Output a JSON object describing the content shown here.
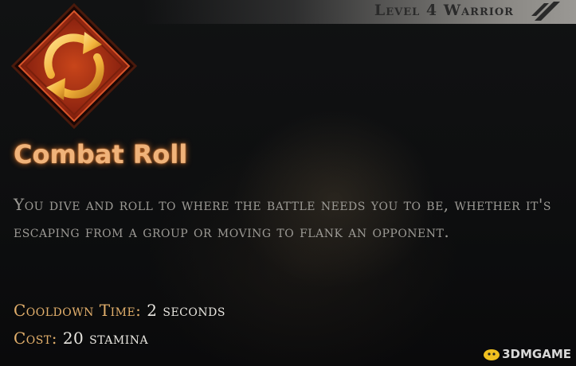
{
  "header": {
    "level_text": "Level 4 Warrior"
  },
  "ability": {
    "icon": "rotate-arrows-icon",
    "title": "Combat Roll",
    "description": "You dive and roll to where the battle needs you to be, whether it's escaping from a group or moving to flank an opponent.",
    "cooldown_label": "Cooldown Time:",
    "cooldown_value": "2 seconds",
    "cost_label": "Cost:",
    "cost_value": "20 stamina"
  },
  "watermark": {
    "text": "3DMGAME"
  },
  "colors": {
    "accent": "#e3b06c",
    "title_glow": "#f0b37a",
    "icon_red": "#b83212",
    "icon_gold": "#f2b33a"
  }
}
